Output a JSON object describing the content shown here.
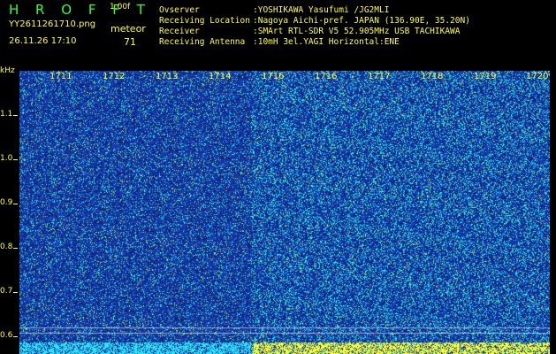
{
  "header": {
    "app_name": "H R O F F T",
    "version": "1.00f",
    "filename": "YY2611261710.png",
    "meteor_label": "meteor",
    "datetime": "26.11.26 17:10",
    "meteor_count": "71"
  },
  "info": [
    {
      "key": "Ovserver",
      "value": ":YOSHIKAWA Yasufumi /JG2MLI"
    },
    {
      "key": "Receiving Location",
      "value": ":Nagoya Aichi-pref. JAPAN (136.90E, 35.20N)"
    },
    {
      "key": "Receiver",
      "value": ":SMArt RTL-SDR V5 52.905MHz USB TACHIKAWA"
    },
    {
      "key": "Receiving Antenna",
      "value": ":10mH 3el.YAGI Horizontal:ENE"
    }
  ],
  "axis": {
    "unit": "kHz",
    "y_labels": [
      "1.1",
      "1.0",
      "0.9",
      "0.8",
      "0.7",
      "0.6"
    ],
    "x_labels": [
      "1711",
      "1712",
      "1713",
      "1714",
      "1716",
      "1716",
      "1717",
      "1718",
      "1719",
      "1720"
    ]
  },
  "colors": {
    "label_yellow": "#ffff33",
    "title_green": "#33ff33",
    "background": "#000000",
    "noise_blue": "#1a2fb0",
    "noise_cyan": "#33ffff"
  }
}
